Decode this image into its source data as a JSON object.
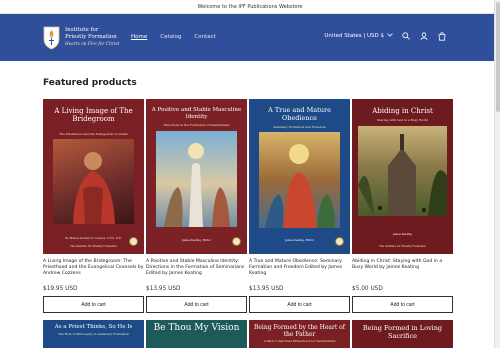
{
  "announcement": "Welcome to the IPF Publications Webstore",
  "logo": {
    "line1": "Institute for",
    "line2": "Priestly Formation",
    "tagline": "Hearts on Fire for Christ"
  },
  "nav": [
    {
      "label": "Home",
      "active": true
    },
    {
      "label": "Catalog",
      "active": false
    },
    {
      "label": "Contact",
      "active": false
    }
  ],
  "header_tools": {
    "region": "United States | USD $",
    "icons": [
      "chevron-down-icon",
      "search-icon",
      "account-icon",
      "cart-icon"
    ]
  },
  "section_title": "Featured products",
  "products": [
    {
      "cover_title": "A Living Image of The Bridegroom",
      "cover_subtitle": "The Priesthood and the Evangelical Counsels",
      "cover_foot": "By Bishop Andrew H. Cozzens, S.T.D., D.D.",
      "cover_publisher": "The Institute for Priestly Formation",
      "cover_color": "#7a1f24",
      "title": "A Living Image of the Bridegroom: The Priesthood and the Evangelical Counsels by Andrew Cozzens",
      "price": "$19.95 USD",
      "button": "Add to cart"
    },
    {
      "cover_title": "A Positive and Stable Masculine Identity",
      "cover_subtitle": "Directions in the Formation of Seminarians",
      "cover_foot": "James Keating, Editor",
      "cover_publisher": "",
      "cover_color": "#7c2125",
      "title": "A Positive and Stable Masculine Identity: Directions in the Formation of Seminarians Edited by James Keating",
      "price": "$13.95 USD",
      "button": "Add to cart"
    },
    {
      "cover_title": "A True and Mature Obedience",
      "cover_subtitle": "Seminary Formation and Freedom",
      "cover_foot": "James Keating, Editor",
      "cover_publisher": "",
      "cover_color": "#1f4a88",
      "title": "A True and Mature Obedience: Seminary Formation and Freedom Edited by James Keating",
      "price": "$13.95 USD",
      "button": "Add to cart"
    },
    {
      "cover_title": "Abiding in Christ",
      "cover_subtitle": "Staying with God in a Busy World",
      "cover_foot": "James Keating",
      "cover_publisher": "The Institute for Priestly Formation",
      "cover_color": "#6e1b20",
      "title": "Abiding in Christ: Staying with God in a Busy World by James Keating",
      "price": "$5.00 USD",
      "button": "Add to cart"
    }
  ],
  "row2": [
    {
      "title": "As a Priest Thinks, So He Is",
      "subtitle": "The Role of Philosophy in Seminary Formation",
      "color": "#1f4a88"
    },
    {
      "title": "Be Thou My Vision",
      "subtitle": "",
      "color": "#1d5b5a"
    },
    {
      "title": "Being Formed by the Heart of the Father",
      "subtitle": "A Path to Spiritual Fatherhood for Seminarians",
      "color": "#7a1f24"
    },
    {
      "title": "Being Formed in Loving Sacrifice",
      "subtitle": "",
      "color": "#6e1b20"
    }
  ],
  "colors": {
    "header_bg": "#2f4f9a",
    "gold": "#f2e2a6"
  }
}
